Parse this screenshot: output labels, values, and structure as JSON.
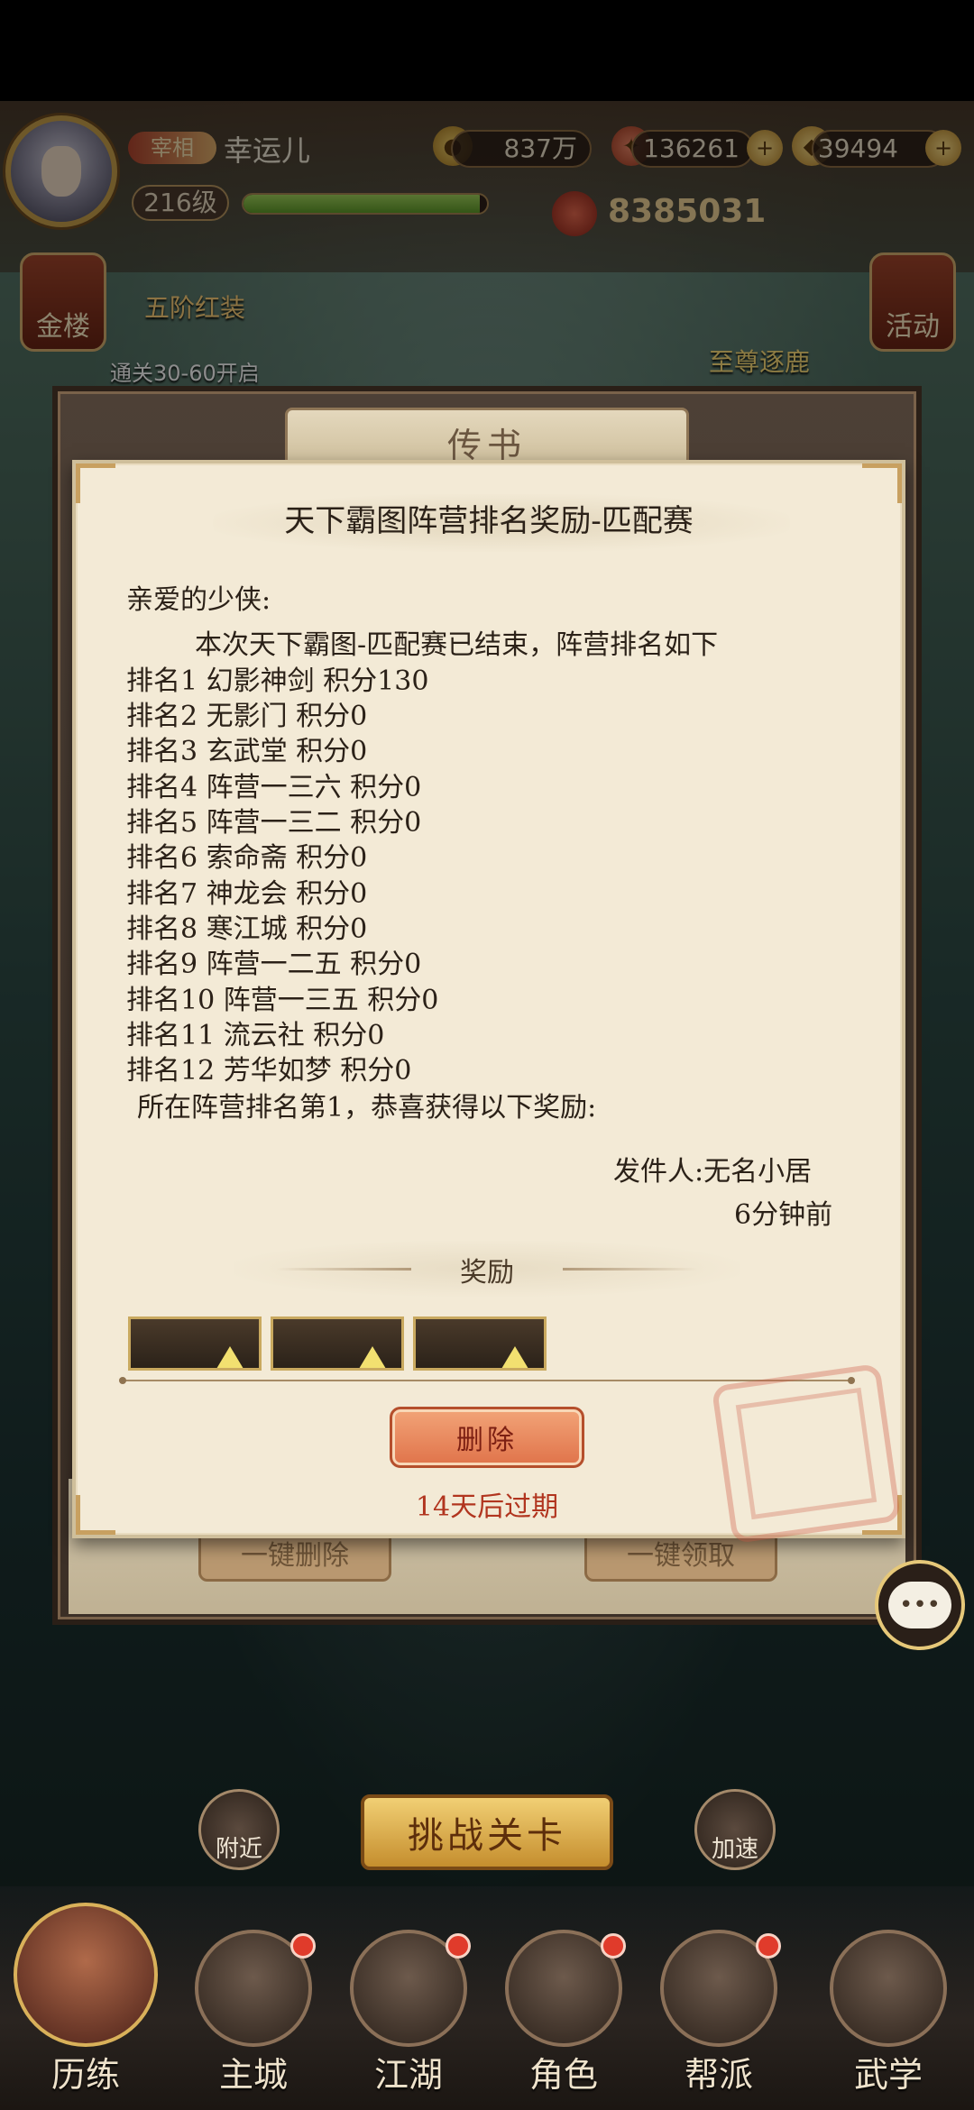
{
  "top_bar": {
    "player_title": "宰相",
    "player_name": "幸运儿",
    "level": "216级",
    "level_progress": 0.97,
    "copper": "837万",
    "jade": "136261",
    "gold": "39494",
    "power": "8385031"
  },
  "side": {
    "gold_tower": "金楼",
    "promo_title": "五阶红装",
    "promo_sub": "通关30-60开启",
    "event_title": "至尊逐鹿",
    "activity": "活动"
  },
  "modal": {
    "header": "传书",
    "under_delete_all": "一键删除",
    "under_claim_all": "一键领取"
  },
  "letter": {
    "title": "天下霸图阵营排名奖励-匹配赛",
    "greeting": "亲爱的少侠:",
    "intro": "本次天下霸图-匹配赛已结束，阵营排名如下",
    "rankings": [
      "排名1 幻影神剑 积分130",
      "排名2 无影门 积分0",
      "排名3 玄武堂 积分0",
      "排名4 阵营一三六 积分0",
      "排名5 阵营一三二 积分0",
      "排名6 索命斋 积分0",
      "排名7 神龙会 积分0",
      "排名8 寒江城 积分0",
      "排名9 阵营一二五 积分0",
      "排名10 阵营一三五 积分0",
      "排名11 流云社 积分0",
      "排名12 芳华如梦 积分0"
    ],
    "conclusion": "所在阵营排名第1，恭喜获得以下奖励:",
    "sender": "发件人:无名小居",
    "time": "6分钟前",
    "reward_title": "奖励",
    "delete_label": "删除",
    "expire": "14天后过期"
  },
  "bottom": {
    "nearby": "附近",
    "challenge": "挑战关卡",
    "speedup": "加速",
    "nav": [
      "历练",
      "主城",
      "江湖",
      "角色",
      "帮派",
      "武学"
    ]
  },
  "colors": {
    "paper": "#f3ead6",
    "delete_button": "#e0734a",
    "expire_text": "#b1351f"
  }
}
